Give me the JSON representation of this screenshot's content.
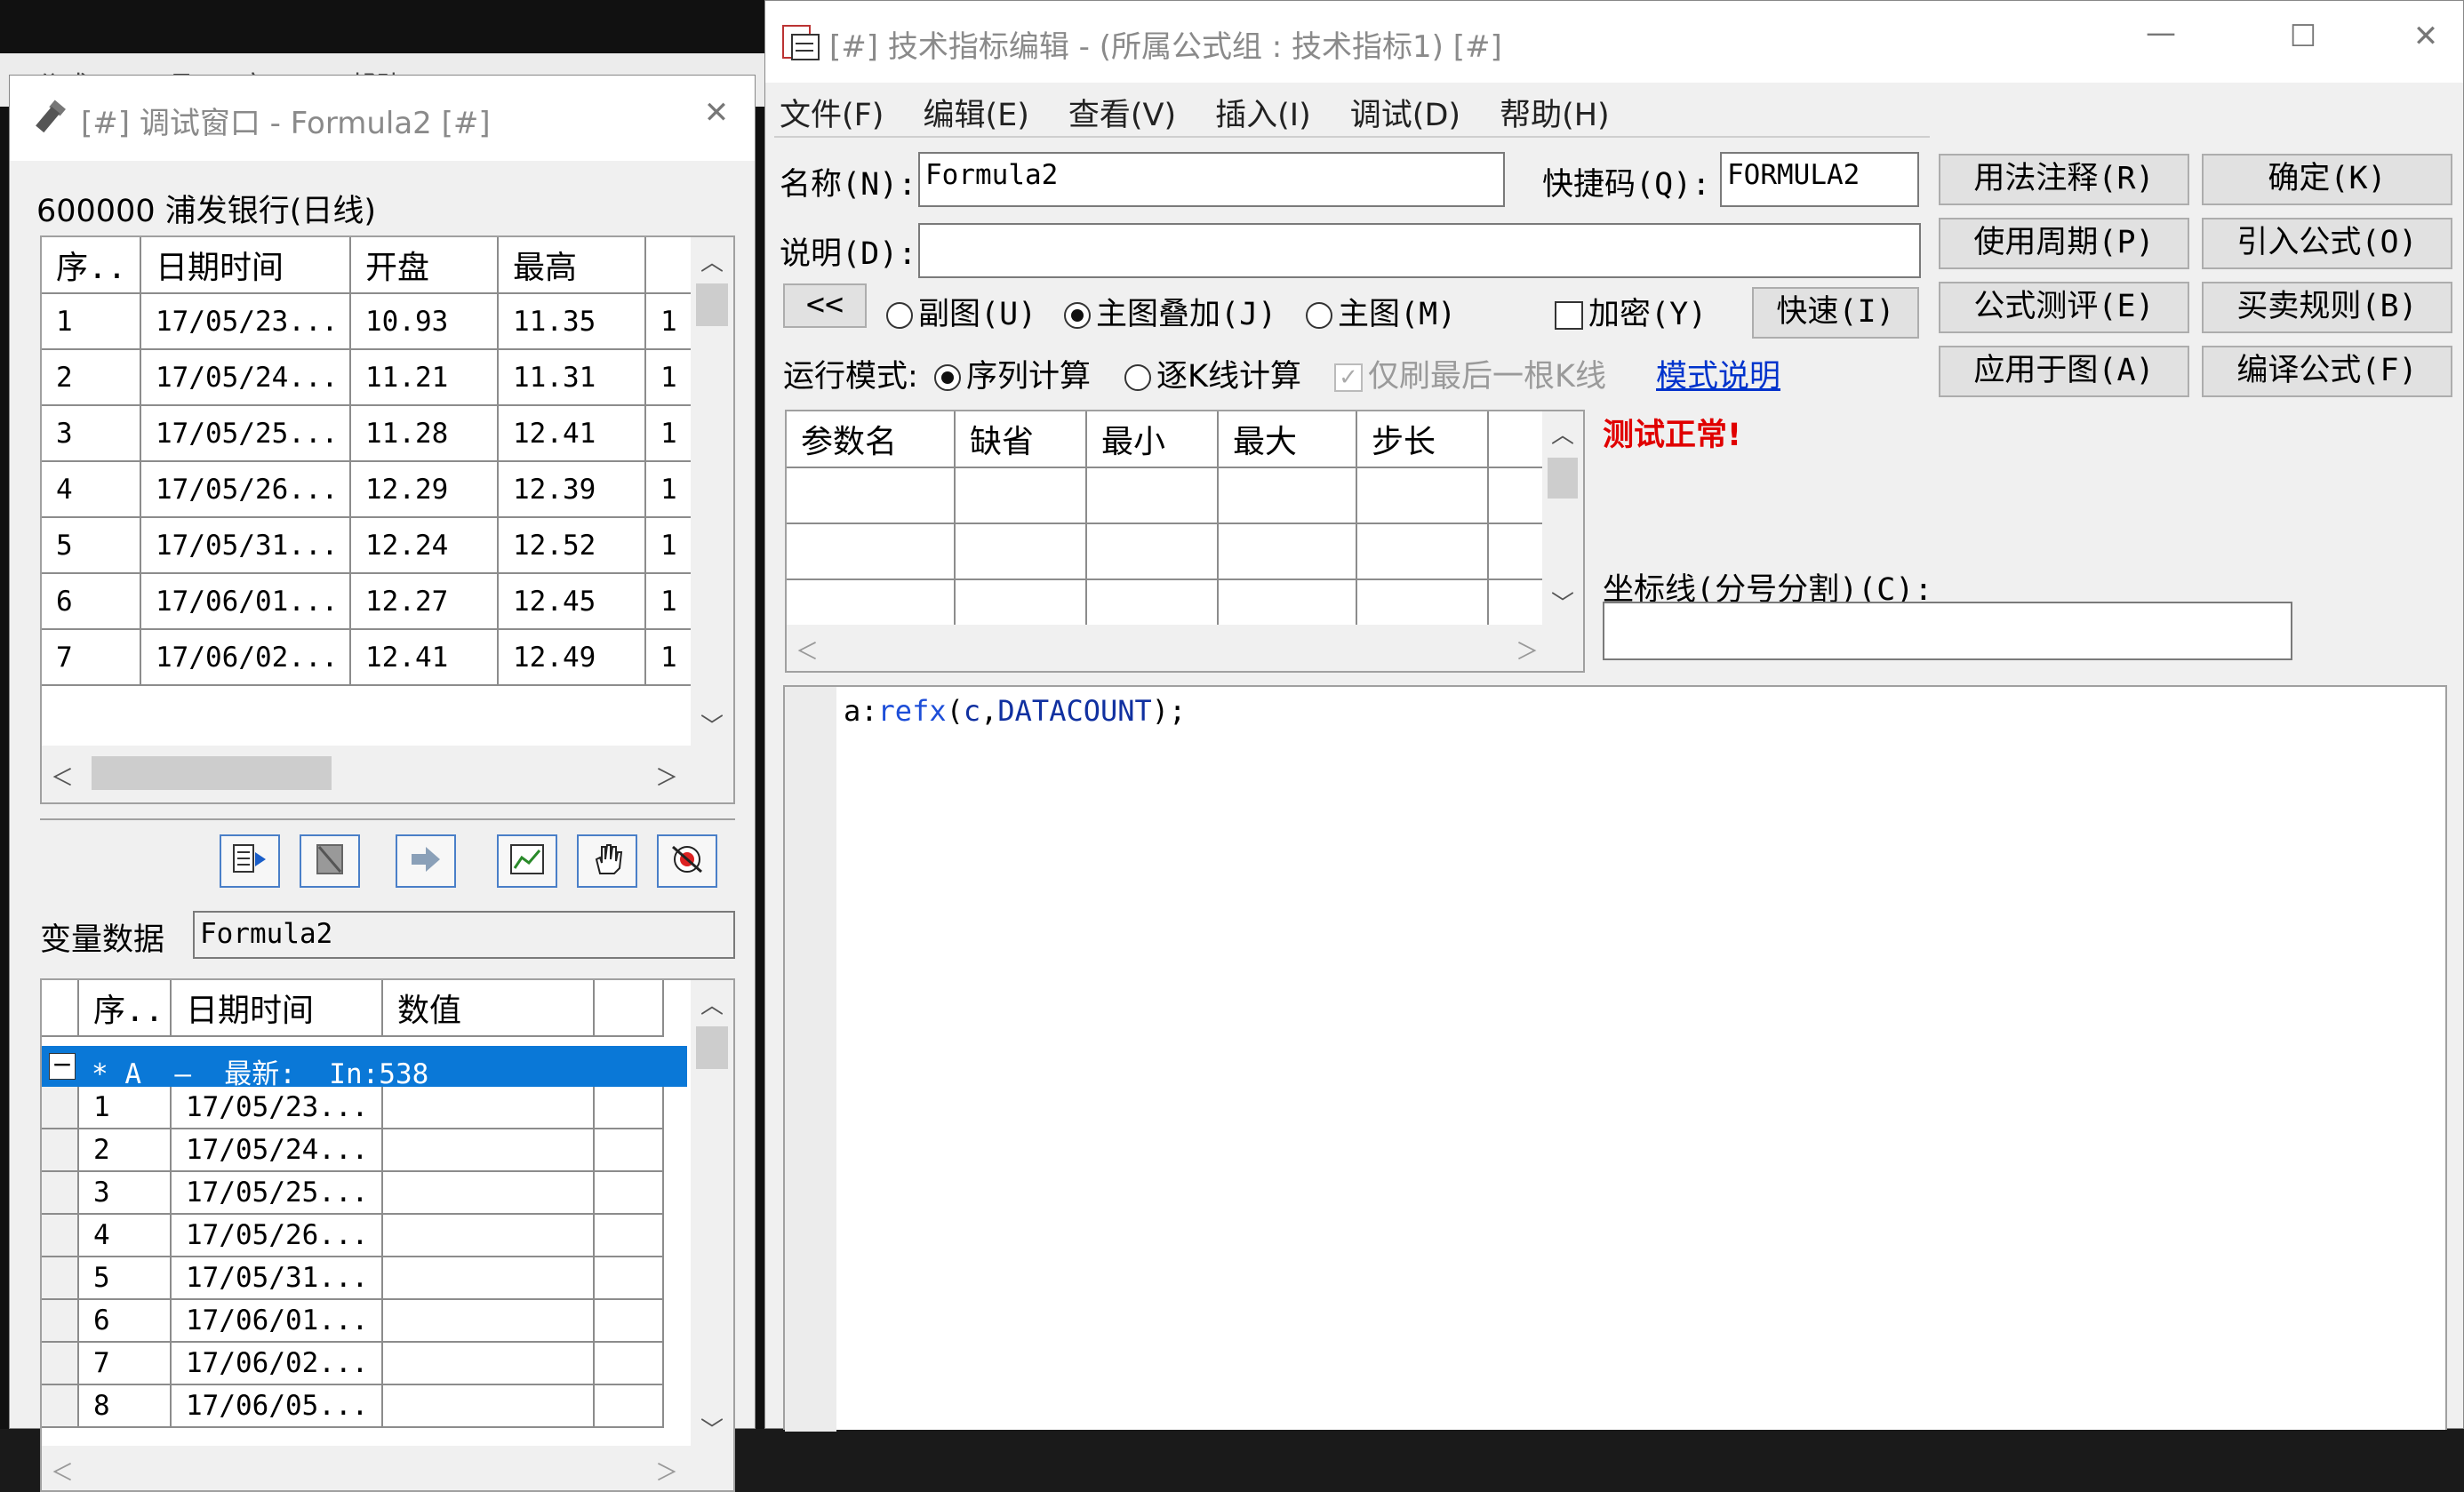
{
  "background_app": {
    "menu_hint": "公式(M)  工具(T)  窗口(W)  帮助(H)"
  },
  "debug_window": {
    "title": "[#] 调试窗口  -  Formula2 [#]",
    "stock_label": "600000 浦发银行(日线)",
    "price_table": {
      "headers": [
        "序..",
        "日期时间",
        "开盘",
        "最高",
        ""
      ],
      "rows": [
        [
          "1",
          "17/05/23...",
          "10.93",
          "11.35",
          "1"
        ],
        [
          "2",
          "17/05/24...",
          "11.21",
          "11.31",
          "1"
        ],
        [
          "3",
          "17/05/25...",
          "11.28",
          "12.41",
          "1"
        ],
        [
          "4",
          "17/05/26...",
          "12.29",
          "12.39",
          "1"
        ],
        [
          "5",
          "17/05/31...",
          "12.24",
          "12.52",
          "1"
        ],
        [
          "6",
          "17/06/01...",
          "12.27",
          "12.45",
          "1"
        ],
        [
          "7",
          "17/06/02...",
          "12.41",
          "12.49",
          "1"
        ]
      ]
    },
    "toolbar_icons": [
      "step-into-icon",
      "stop-debug-icon",
      "run-to-icon",
      "chart-icon",
      "hand-icon",
      "clear-breakpoints-icon"
    ],
    "var_label": "变量数据",
    "var_value": "Formula2",
    "var_table": {
      "headers": [
        "",
        "序..",
        "日期时间",
        "数值",
        ""
      ],
      "group_row": "* A  –  最新:  In:538",
      "rows": [
        [
          "1",
          "17/05/23..."
        ],
        [
          "2",
          "17/05/24..."
        ],
        [
          "3",
          "17/05/25..."
        ],
        [
          "4",
          "17/05/26..."
        ],
        [
          "5",
          "17/05/31..."
        ],
        [
          "6",
          "17/06/01..."
        ],
        [
          "7",
          "17/06/02..."
        ],
        [
          "8",
          "17/06/05..."
        ]
      ]
    }
  },
  "editor_window": {
    "title": "[#] 技术指标编辑 - (所属公式组 : 技术指标1) [#]",
    "menu": [
      "文件(F)",
      "编辑(E)",
      "查看(V)",
      "插入(I)",
      "调试(D)",
      "帮助(H)"
    ],
    "name_label": "名称(N):",
    "name_value": "Formula2",
    "shortcut_label": "快捷码(Q):",
    "shortcut_value": "FORMULA2",
    "desc_label": "说明(D):",
    "desc_value": "",
    "collapse_button": "<<",
    "radio_sub": "副图(U)",
    "radio_overlay": "主图叠加(J)",
    "radio_main": "主图(M)",
    "encrypt_label": "加密(Y)",
    "quick_button": "快速(I)",
    "run_mode_label": "运行模式:",
    "radio_series": "序列计算",
    "radio_kline": "逐K线计算",
    "check_last_bar": "仅刷最后一根K线",
    "mode_link": "模式说明",
    "buttons": {
      "usage": "用法注释(R)",
      "ok": "确定(K)",
      "period": "使用周期(P)",
      "import": "引入公式(O)",
      "evaluate": "公式测评(E)",
      "trade_rules": "买卖规则(B)",
      "apply": "应用于图(A)",
      "compile": "编译公式(F)"
    },
    "param_headers": [
      "参数名",
      "缺省",
      "最小",
      "最大",
      "步长"
    ],
    "status": "测试正常!",
    "coord_label": "坐标线(分号分割)(C):",
    "coord_value": "",
    "code": {
      "var": "a",
      "op": ":",
      "func": "refx",
      "open": "(",
      "arg1": "c",
      "comma": ",",
      "arg2": "DATACOUNT",
      "close": ");"
    },
    "colors": {
      "status": "#e00000",
      "link": "#0033cc",
      "func": "#1d4ed8",
      "code_arg": "#1030a0",
      "selection": "#0a78d7"
    }
  }
}
